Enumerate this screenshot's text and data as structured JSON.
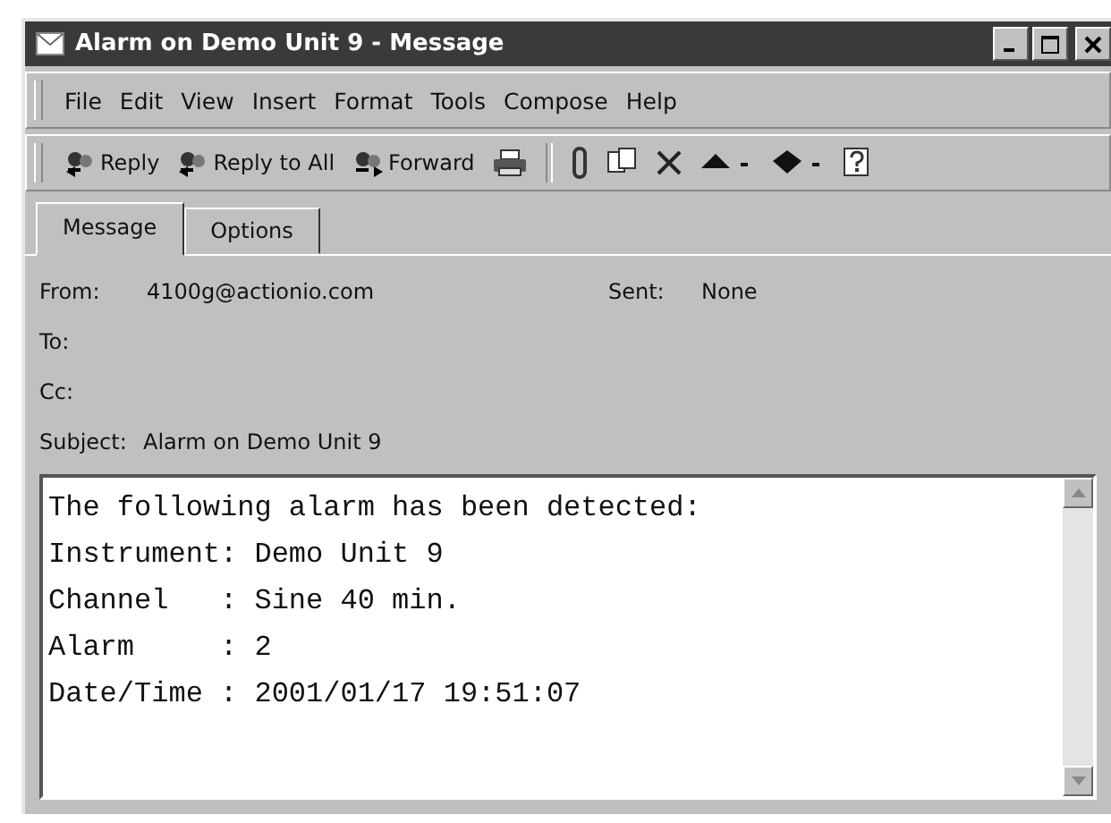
{
  "window": {
    "title": "Alarm on Demo Unit 9 - Message"
  },
  "menu": [
    "File",
    "Edit",
    "View",
    "Insert",
    "Format",
    "Tools",
    "Compose",
    "Help"
  ],
  "toolbar": [
    {
      "kind": "reply",
      "label": "Reply"
    },
    {
      "kind": "replyall",
      "label": "Reply to All"
    },
    {
      "kind": "forward",
      "label": "Forward"
    },
    {
      "kind": "print"
    },
    {
      "kind": "separator"
    },
    {
      "kind": "attach"
    },
    {
      "kind": "copy"
    },
    {
      "kind": "delete"
    },
    {
      "kind": "up"
    },
    {
      "kind": "down"
    },
    {
      "kind": "help"
    }
  ],
  "tabs": [
    {
      "label": "Message",
      "selected": true
    },
    {
      "label": "Options",
      "selected": false
    }
  ],
  "header": {
    "from_label": "From:",
    "from": "4100g@actionio.com",
    "sent_label": "Sent:",
    "sent": "None",
    "to_label": "To:",
    "cc_label": "Cc:",
    "subject_label": "Subject:",
    "subject": "Alarm on Demo Unit 9"
  },
  "body": [
    "The following alarm has been detected:",
    "Instrument: Demo Unit 9",
    "Channel   : Sine 40 min.",
    "Alarm     : 2",
    "Date/Time : 2001/01/17 19:51:07"
  ]
}
